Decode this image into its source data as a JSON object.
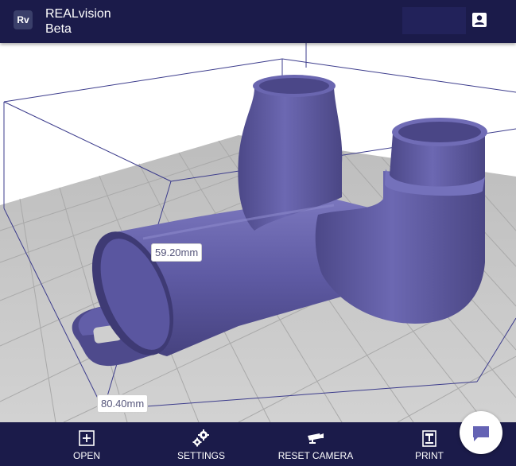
{
  "header": {
    "logo_text": "Rv",
    "title": "REALvision",
    "subtitle": "Beta",
    "account_icon": "account-box-icon"
  },
  "viewport": {
    "dimension_width": "59.20mm",
    "dimension_depth": "80.40mm",
    "model_color": "#5e5aa0",
    "bed_color": "#cfcfcf",
    "grid_color": "#a9a9a9",
    "build_volume_color": "#3c3c8c"
  },
  "toolbar": {
    "open_label": "OPEN",
    "open_icon": "plus-box-icon",
    "settings_label": "SETTINGS",
    "settings_icon": "gears-icon",
    "reset_camera_label": "RESET CAMERA",
    "reset_camera_icon": "camera-icon",
    "print_label": "PRINT",
    "print_icon": "printer-icon"
  },
  "chat": {
    "icon": "chat-bubble-icon"
  },
  "colors": {
    "header_bg": "#1b1b4a",
    "toolbar_bg": "#1b1b4a"
  }
}
